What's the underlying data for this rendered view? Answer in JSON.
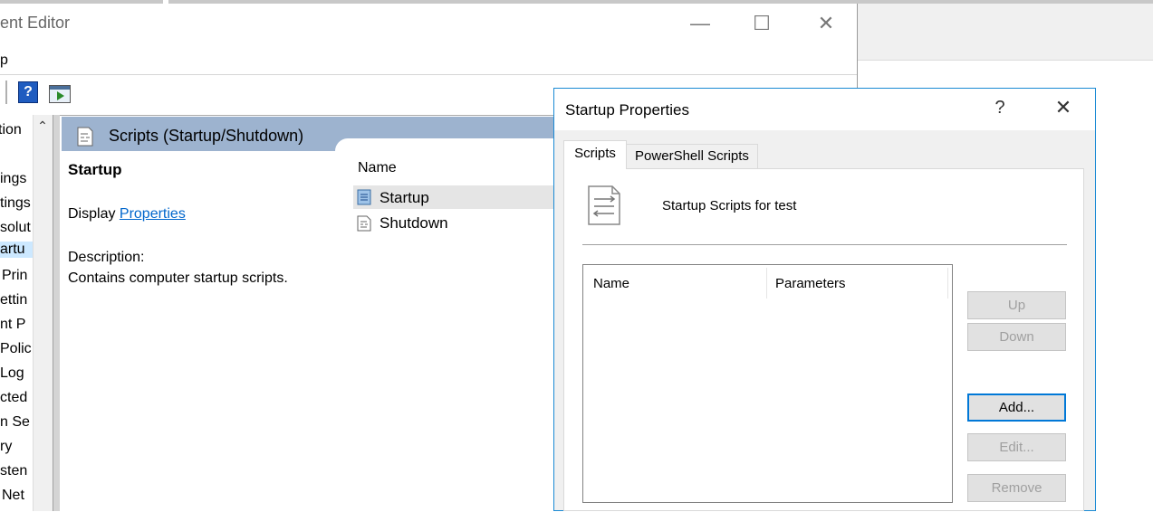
{
  "window": {
    "title_partial": "ent Editor",
    "menu_partial": "p",
    "toolbar": {
      "help_icon": "?"
    }
  },
  "tree": {
    "scroll_up": "^",
    "items": [
      "tion",
      "ings",
      "tings",
      "solut",
      "artu",
      "Prin",
      "ettin",
      "nt P",
      "Polic",
      "Log",
      "cted",
      "n Se",
      "ry",
      "sten",
      "Net"
    ]
  },
  "content": {
    "header_title": "Scripts (Startup/Shutdown)",
    "section_title": "Startup",
    "display_prefix": "Display ",
    "display_link": "Properties",
    "description_label": "Description:",
    "description_text": "Contains computer startup scripts.",
    "column_name": "Name",
    "rows": [
      {
        "label": "Startup",
        "icon": "script-icon",
        "selected": true
      },
      {
        "label": "Shutdown",
        "icon": "script-icon",
        "selected": false
      }
    ]
  },
  "dialog": {
    "title": "Startup Properties",
    "help": "?",
    "close": "✕",
    "tabs": [
      "Scripts",
      "PowerShell Scripts"
    ],
    "panel_title": "Startup Scripts for test",
    "list_headers": [
      "Name",
      "Parameters"
    ],
    "buttons": {
      "up": "Up",
      "down": "Down",
      "add": "Add...",
      "edit": "Edit...",
      "remove": "Remove"
    }
  }
}
